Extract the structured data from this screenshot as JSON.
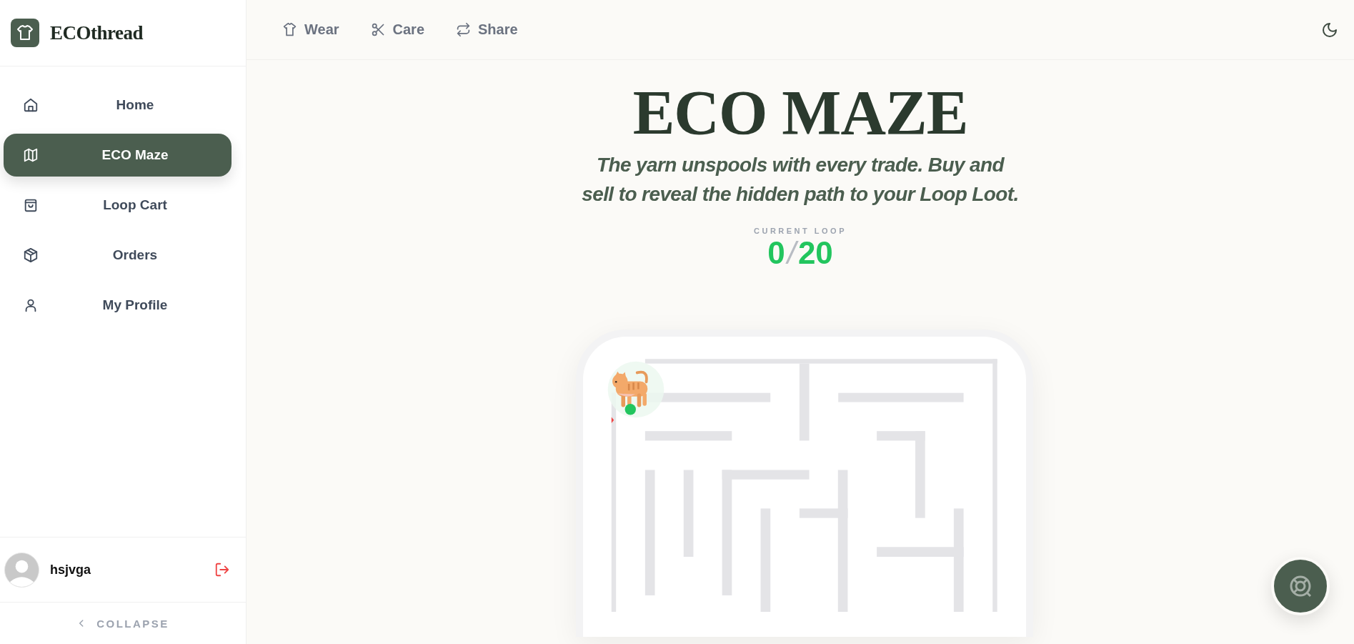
{
  "brand": {
    "name": "ECOthread"
  },
  "nav": [
    {
      "label": "Home",
      "selected": false
    },
    {
      "label": "ECO Maze",
      "selected": true
    },
    {
      "label": "Loop Cart",
      "selected": false
    },
    {
      "label": "Orders",
      "selected": false
    },
    {
      "label": "My Profile",
      "selected": false
    }
  ],
  "user": {
    "name": "hsjvga"
  },
  "collapse": {
    "label": "COLLAPSE"
  },
  "top_nav": [
    {
      "label": "Wear"
    },
    {
      "label": "Care"
    },
    {
      "label": "Share"
    }
  ],
  "page": {
    "title": "ECO MAZE",
    "subtitle": "The yarn unspools with every trade. Buy and sell to reveal the hidden path to your Loop Loot.",
    "loop_label": "CURRENT LOOP",
    "loop_current": "0",
    "loop_separator": "/",
    "loop_total": "20"
  }
}
